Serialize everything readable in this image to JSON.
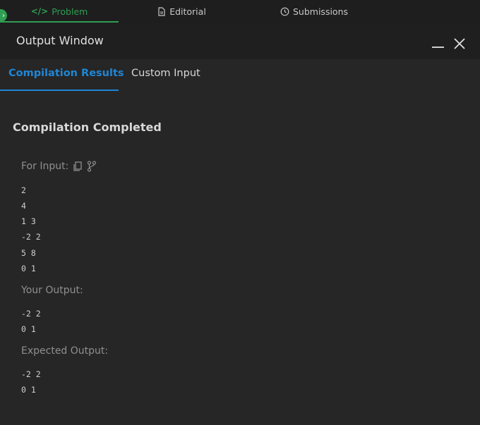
{
  "top_tabs": [
    {
      "label": "Problem",
      "icon": "code-icon",
      "active": true
    },
    {
      "label": "Editorial",
      "icon": "document-icon",
      "active": false
    },
    {
      "label": "Submissions",
      "icon": "clock-icon",
      "active": false
    }
  ],
  "window": {
    "title": "Output Window"
  },
  "result_tabs": [
    {
      "label": "Compilation Results",
      "active": true
    },
    {
      "label": "Custom Input",
      "active": false
    }
  ],
  "status": "Compilation Completed",
  "sections": {
    "input_label": "For Input:",
    "input_lines": [
      "2",
      "4",
      "1 3",
      "-2 2",
      "5 8",
      "0 1"
    ],
    "output_label": "Your Output:",
    "output_lines": [
      "-2 2",
      "0 1"
    ],
    "expected_label": "Expected Output:",
    "expected_lines": [
      "-2 2",
      "0 1"
    ]
  },
  "colors": {
    "accent_green": "#2f9e52",
    "accent_blue": "#1f86d6",
    "background": "#262626"
  }
}
